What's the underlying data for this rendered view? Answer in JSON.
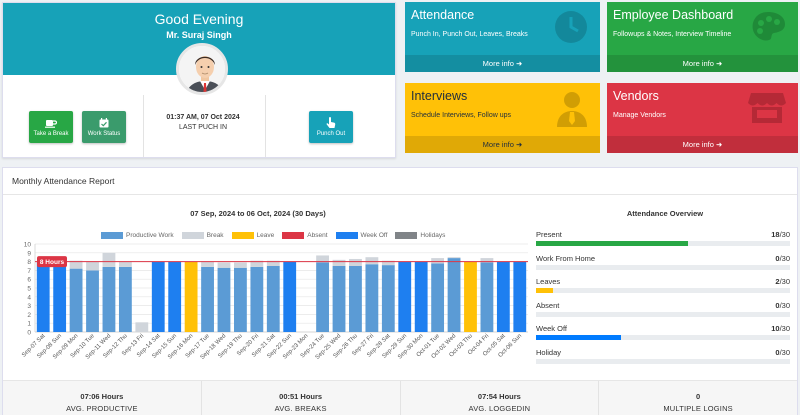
{
  "welcome": {
    "greeting": "Good Evening",
    "user_name": "Mr. Suraj Singh",
    "punch_time": "01:37 AM, 07 Oct 2024",
    "punch_label": "LAST PUCH IN",
    "take_break_label": "Take a Break",
    "work_status_label": "Work Status",
    "punch_out_label": "Punch Out"
  },
  "tiles": {
    "attendance": {
      "title": "Attendance",
      "subtitle": "Punch In, Punch Out, Leaves, Breaks",
      "more": "More info",
      "color": "#17a2b8",
      "icon": "clock-icon"
    },
    "employee": {
      "title": "Employee Dashboard",
      "subtitle": "Followups & Notes, Interview Timeline",
      "more": "More info",
      "color": "#28a745",
      "icon": "palette-icon"
    },
    "interviews": {
      "title": "Interviews",
      "subtitle": "Schedule Interviews, Follow ups",
      "more": "More info",
      "color": "#ffc107",
      "icon": "user-tie-icon"
    },
    "vendors": {
      "title": "Vendors",
      "subtitle": "Manage Vendors",
      "more": "More info",
      "color": "#dc3545",
      "icon": "store-icon"
    }
  },
  "report": {
    "title": "Monthly Attendance Report",
    "range": "07 Sep, 2024 to 06 Oct, 2024 (30 Days)",
    "overview_title": "Attendance Overview",
    "overview": [
      {
        "label": "Present",
        "value": "18",
        "total": "/30",
        "fraction": 0.6,
        "color": "#28a745"
      },
      {
        "label": "Work From Home",
        "value": "0",
        "total": "/30",
        "fraction": 0,
        "color": "#17a2b8"
      },
      {
        "label": "Leaves",
        "value": "2",
        "total": "/30",
        "fraction": 0.0667,
        "color": "#ffc107"
      },
      {
        "label": "Absent",
        "value": "0",
        "total": "/30",
        "fraction": 0,
        "color": "#dc3545"
      },
      {
        "label": "Week Off",
        "value": "10",
        "total": "/30",
        "fraction": 0.3333,
        "color": "#007bff"
      },
      {
        "label": "Holiday",
        "value": "0",
        "total": "/30",
        "fraction": 0,
        "color": "#6c757d"
      }
    ],
    "stats": [
      {
        "value": "07:06 Hours",
        "label": "AVG. PRODUCTIVE"
      },
      {
        "value": "00:51 Hours",
        "label": "AVG. BREAKS"
      },
      {
        "value": "07:54 Hours",
        "label": "AVG. LOGGEDIN"
      },
      {
        "value": "0",
        "label": "MULTIPLE LOGINS"
      }
    ]
  },
  "chart_data": {
    "type": "bar",
    "stacked": true,
    "legend_position": "top",
    "grid": true,
    "ylim": [
      0,
      10
    ],
    "yticks": [
      0,
      1,
      2,
      3,
      4,
      5,
      6,
      7,
      8,
      9,
      10
    ],
    "threshold": {
      "value": 8,
      "label": "8 Hours",
      "color": "#dc3545"
    },
    "categories": [
      "Sep-07 Sat",
      "Sep-08 Sun",
      "Sep-09 Mon",
      "Sep-10 Tue",
      "Sep-11 Wed",
      "Sep-12 Thu",
      "Sep-13 Fri",
      "Sep-14 Sat",
      "Sep-15 Sun",
      "Sep-16 Mon",
      "Sep-17 Tue",
      "Sep-18 Wed",
      "Sep-19 Thu",
      "Sep-20 Fri",
      "Sep-21 Sat",
      "Sep-22 Sun",
      "Sep-23 Mon",
      "Sep-24 Tue",
      "Sep-25 Wed",
      "Sep-26 Thu",
      "Sep-27 Fri",
      "Sep-28 Sat",
      "Sep-29 Sun",
      "Sep-30 Mon",
      "Oct-01 Tue",
      "Oct-02 Wed",
      "Oct-03 Thu",
      "Oct-04 Fri",
      "Oct-05 Sat",
      "Oct-06 Sun"
    ],
    "series": [
      {
        "name": "Productive Work",
        "color": "#5b9bd5",
        "values": [
          0,
          0,
          7.2,
          7.0,
          7.4,
          7.4,
          0,
          0,
          0,
          0,
          7.4,
          7.3,
          7.3,
          7.4,
          7.5,
          0,
          0,
          7.9,
          7.5,
          7.5,
          7.7,
          7.6,
          0,
          0,
          7.8,
          8.4,
          0,
          7.9,
          0,
          0
        ]
      },
      {
        "name": "Break",
        "color": "#d0d5db",
        "values": [
          0,
          0,
          0.9,
          1.0,
          1.6,
          0.6,
          1.1,
          0,
          0,
          0,
          0.6,
          0.6,
          0.6,
          0.7,
          0.6,
          0,
          0,
          0.8,
          0.7,
          0.8,
          0.8,
          0.5,
          0,
          0,
          0.6,
          0.1,
          0,
          0.5,
          0,
          0
        ]
      },
      {
        "name": "Leave",
        "color": "#ffc107",
        "values": [
          0,
          0,
          0,
          0,
          0,
          0,
          0,
          0,
          0,
          8,
          0,
          0,
          0,
          0,
          0,
          0,
          0,
          0,
          0,
          0,
          0,
          0,
          0,
          0,
          0,
          0,
          8,
          0,
          0,
          0
        ]
      },
      {
        "name": "Absent",
        "color": "#dc3545",
        "values": [
          0,
          0,
          0,
          0,
          0,
          0,
          0,
          0,
          0,
          0,
          0,
          0,
          0,
          0,
          0,
          0,
          0,
          0,
          0,
          0,
          0,
          0,
          0,
          0,
          0,
          0,
          0,
          0,
          0,
          0
        ]
      },
      {
        "name": "Week Off",
        "color": "#1e7ff0",
        "values": [
          8,
          8,
          0,
          0,
          0,
          0,
          0,
          8,
          8,
          0,
          0,
          0,
          0,
          0,
          0,
          8,
          0,
          0,
          0,
          0,
          0,
          0,
          8,
          8,
          0,
          0,
          0,
          0,
          8,
          8
        ]
      },
      {
        "name": "Holidays",
        "color": "#808488",
        "values": [
          0,
          0,
          0,
          0,
          0,
          0,
          0,
          0,
          0,
          0,
          0,
          0,
          0,
          0,
          0,
          0,
          0,
          0,
          0,
          0,
          0,
          0,
          0,
          0,
          0,
          0,
          0,
          0,
          0,
          0
        ]
      }
    ]
  }
}
